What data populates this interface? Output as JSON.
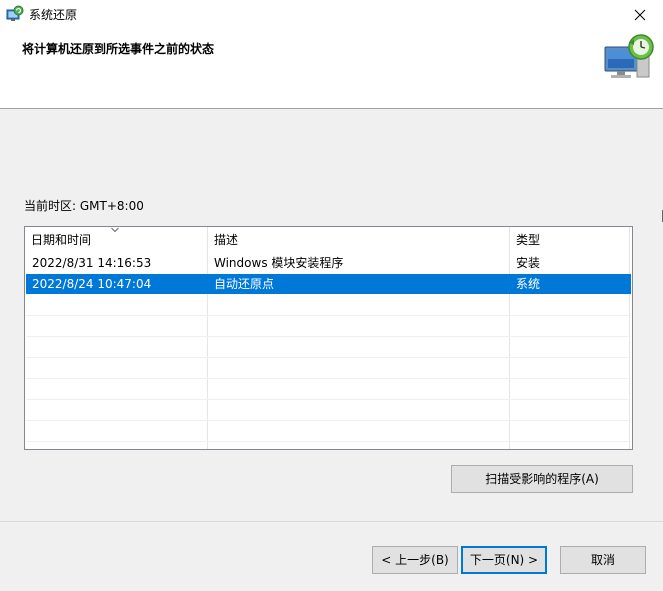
{
  "window": {
    "title": "系统还原",
    "close_label": "×"
  },
  "header": {
    "title": "将计算机还原到所选事件之前的状态"
  },
  "timezone_label": "当前时区: GMT+8:00",
  "table": {
    "columns": [
      "日期和时间",
      "描述",
      "类型"
    ],
    "sorted_column": "日期和时间",
    "rows": [
      {
        "datetime": "2022/8/31 14:16:53",
        "description": "Windows 模块安装程序",
        "type": "安装",
        "selected": false
      },
      {
        "datetime": "2022/8/24 10:47:04",
        "description": "自动还原点",
        "type": "系统",
        "selected": true
      }
    ]
  },
  "buttons": {
    "scan": "扫描受影响的程序(A)",
    "back": "< 上一步(B)",
    "next": "下一页(N) >",
    "cancel": "取消"
  },
  "colors": {
    "selection": "#0078d7",
    "dialog_bg": "#f0f0f0",
    "button_bg": "#e1e1e1"
  }
}
